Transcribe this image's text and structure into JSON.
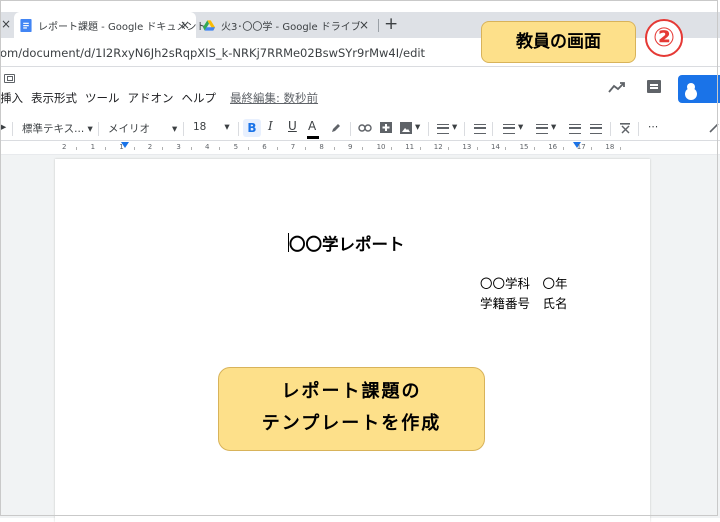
{
  "browser": {
    "tabs": [
      {
        "title": "レポート課題 - Google ドキュメント",
        "icon": "google-docs-icon",
        "active": true
      },
      {
        "title": "火3･〇〇学 - Google ドライブ",
        "icon": "google-drive-icon",
        "active": false
      }
    ],
    "close_glyph": "×",
    "new_tab_glyph": "+",
    "url": "om/document/d/1I2RxyN6Jh2sRqpXIS_k-NRKj7RRMe02BswSYr9rMw4I/edit"
  },
  "menu": {
    "items": [
      "挿入",
      "表示形式",
      "ツール",
      "アドオン",
      "ヘルプ"
    ],
    "last_edit": "最終編集: 数秒前"
  },
  "toolbar": {
    "style_select": "標準テキス...",
    "font_select": "メイリオ",
    "font_size": "18",
    "bold": "B",
    "italic": "I",
    "underline": "U",
    "text_color": "A",
    "more": "⋯"
  },
  "ruler": {
    "labels": [
      "2",
      "1",
      "1",
      "2",
      "3",
      "4",
      "5",
      "6",
      "7",
      "8",
      "9",
      "10",
      "11",
      "12",
      "13",
      "14",
      "15",
      "16",
      "17",
      "18"
    ]
  },
  "document": {
    "title": "〇〇学レポート",
    "line1": "〇〇学科　〇年",
    "line2": "学籍番号　氏名"
  },
  "annotations": {
    "top_label": "教員の画面",
    "step": "②",
    "main_line1": "レポート課題の",
    "main_line2": "テンプレートを作成"
  },
  "colors": {
    "callout_fill": "#fde08a",
    "step_red": "#e53935",
    "accent_blue": "#1a73e8",
    "docs_blue": "#4285f4"
  }
}
